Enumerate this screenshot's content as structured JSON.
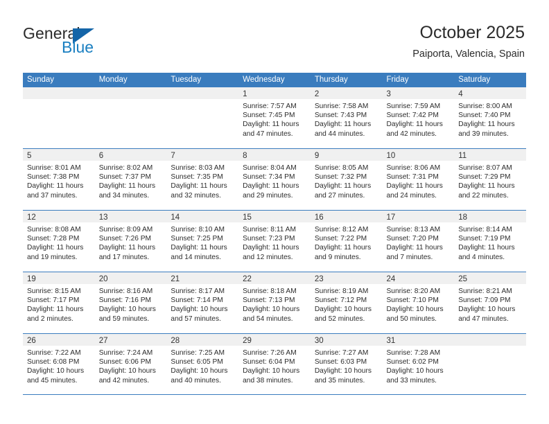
{
  "brand": {
    "name_part1": "General",
    "name_part2": "Blue",
    "logo_icon": "triangle-logo-icon",
    "accent_color": "#1a7fc1"
  },
  "header": {
    "title": "October 2025",
    "subtitle": "Paiporta, Valencia, Spain"
  },
  "theme": {
    "header_blue": "#3a7cbe",
    "date_band_gray": "#f0f0f0",
    "text_color": "#2b2b2b"
  },
  "calendar": {
    "weekday_headers": [
      "Sunday",
      "Monday",
      "Tuesday",
      "Wednesday",
      "Thursday",
      "Friday",
      "Saturday"
    ],
    "weeks": [
      [
        {
          "date": "",
          "empty": true
        },
        {
          "date": "",
          "empty": true
        },
        {
          "date": "",
          "empty": true
        },
        {
          "date": "1",
          "sunrise": "Sunrise: 7:57 AM",
          "sunset": "Sunset: 7:45 PM",
          "daylight": "Daylight: 11 hours and 47 minutes."
        },
        {
          "date": "2",
          "sunrise": "Sunrise: 7:58 AM",
          "sunset": "Sunset: 7:43 PM",
          "daylight": "Daylight: 11 hours and 44 minutes."
        },
        {
          "date": "3",
          "sunrise": "Sunrise: 7:59 AM",
          "sunset": "Sunset: 7:42 PM",
          "daylight": "Daylight: 11 hours and 42 minutes."
        },
        {
          "date": "4",
          "sunrise": "Sunrise: 8:00 AM",
          "sunset": "Sunset: 7:40 PM",
          "daylight": "Daylight: 11 hours and 39 minutes."
        }
      ],
      [
        {
          "date": "5",
          "sunrise": "Sunrise: 8:01 AM",
          "sunset": "Sunset: 7:38 PM",
          "daylight": "Daylight: 11 hours and 37 minutes."
        },
        {
          "date": "6",
          "sunrise": "Sunrise: 8:02 AM",
          "sunset": "Sunset: 7:37 PM",
          "daylight": "Daylight: 11 hours and 34 minutes."
        },
        {
          "date": "7",
          "sunrise": "Sunrise: 8:03 AM",
          "sunset": "Sunset: 7:35 PM",
          "daylight": "Daylight: 11 hours and 32 minutes."
        },
        {
          "date": "8",
          "sunrise": "Sunrise: 8:04 AM",
          "sunset": "Sunset: 7:34 PM",
          "daylight": "Daylight: 11 hours and 29 minutes."
        },
        {
          "date": "9",
          "sunrise": "Sunrise: 8:05 AM",
          "sunset": "Sunset: 7:32 PM",
          "daylight": "Daylight: 11 hours and 27 minutes."
        },
        {
          "date": "10",
          "sunrise": "Sunrise: 8:06 AM",
          "sunset": "Sunset: 7:31 PM",
          "daylight": "Daylight: 11 hours and 24 minutes."
        },
        {
          "date": "11",
          "sunrise": "Sunrise: 8:07 AM",
          "sunset": "Sunset: 7:29 PM",
          "daylight": "Daylight: 11 hours and 22 minutes."
        }
      ],
      [
        {
          "date": "12",
          "sunrise": "Sunrise: 8:08 AM",
          "sunset": "Sunset: 7:28 PM",
          "daylight": "Daylight: 11 hours and 19 minutes."
        },
        {
          "date": "13",
          "sunrise": "Sunrise: 8:09 AM",
          "sunset": "Sunset: 7:26 PM",
          "daylight": "Daylight: 11 hours and 17 minutes."
        },
        {
          "date": "14",
          "sunrise": "Sunrise: 8:10 AM",
          "sunset": "Sunset: 7:25 PM",
          "daylight": "Daylight: 11 hours and 14 minutes."
        },
        {
          "date": "15",
          "sunrise": "Sunrise: 8:11 AM",
          "sunset": "Sunset: 7:23 PM",
          "daylight": "Daylight: 11 hours and 12 minutes."
        },
        {
          "date": "16",
          "sunrise": "Sunrise: 8:12 AM",
          "sunset": "Sunset: 7:22 PM",
          "daylight": "Daylight: 11 hours and 9 minutes."
        },
        {
          "date": "17",
          "sunrise": "Sunrise: 8:13 AM",
          "sunset": "Sunset: 7:20 PM",
          "daylight": "Daylight: 11 hours and 7 minutes."
        },
        {
          "date": "18",
          "sunrise": "Sunrise: 8:14 AM",
          "sunset": "Sunset: 7:19 PM",
          "daylight": "Daylight: 11 hours and 4 minutes."
        }
      ],
      [
        {
          "date": "19",
          "sunrise": "Sunrise: 8:15 AM",
          "sunset": "Sunset: 7:17 PM",
          "daylight": "Daylight: 11 hours and 2 minutes."
        },
        {
          "date": "20",
          "sunrise": "Sunrise: 8:16 AM",
          "sunset": "Sunset: 7:16 PM",
          "daylight": "Daylight: 10 hours and 59 minutes."
        },
        {
          "date": "21",
          "sunrise": "Sunrise: 8:17 AM",
          "sunset": "Sunset: 7:14 PM",
          "daylight": "Daylight: 10 hours and 57 minutes."
        },
        {
          "date": "22",
          "sunrise": "Sunrise: 8:18 AM",
          "sunset": "Sunset: 7:13 PM",
          "daylight": "Daylight: 10 hours and 54 minutes."
        },
        {
          "date": "23",
          "sunrise": "Sunrise: 8:19 AM",
          "sunset": "Sunset: 7:12 PM",
          "daylight": "Daylight: 10 hours and 52 minutes."
        },
        {
          "date": "24",
          "sunrise": "Sunrise: 8:20 AM",
          "sunset": "Sunset: 7:10 PM",
          "daylight": "Daylight: 10 hours and 50 minutes."
        },
        {
          "date": "25",
          "sunrise": "Sunrise: 8:21 AM",
          "sunset": "Sunset: 7:09 PM",
          "daylight": "Daylight: 10 hours and 47 minutes."
        }
      ],
      [
        {
          "date": "26",
          "sunrise": "Sunrise: 7:22 AM",
          "sunset": "Sunset: 6:08 PM",
          "daylight": "Daylight: 10 hours and 45 minutes."
        },
        {
          "date": "27",
          "sunrise": "Sunrise: 7:24 AM",
          "sunset": "Sunset: 6:06 PM",
          "daylight": "Daylight: 10 hours and 42 minutes."
        },
        {
          "date": "28",
          "sunrise": "Sunrise: 7:25 AM",
          "sunset": "Sunset: 6:05 PM",
          "daylight": "Daylight: 10 hours and 40 minutes."
        },
        {
          "date": "29",
          "sunrise": "Sunrise: 7:26 AM",
          "sunset": "Sunset: 6:04 PM",
          "daylight": "Daylight: 10 hours and 38 minutes."
        },
        {
          "date": "30",
          "sunrise": "Sunrise: 7:27 AM",
          "sunset": "Sunset: 6:03 PM",
          "daylight": "Daylight: 10 hours and 35 minutes."
        },
        {
          "date": "31",
          "sunrise": "Sunrise: 7:28 AM",
          "sunset": "Sunset: 6:02 PM",
          "daylight": "Daylight: 10 hours and 33 minutes."
        },
        {
          "date": "",
          "empty": true
        }
      ]
    ]
  }
}
